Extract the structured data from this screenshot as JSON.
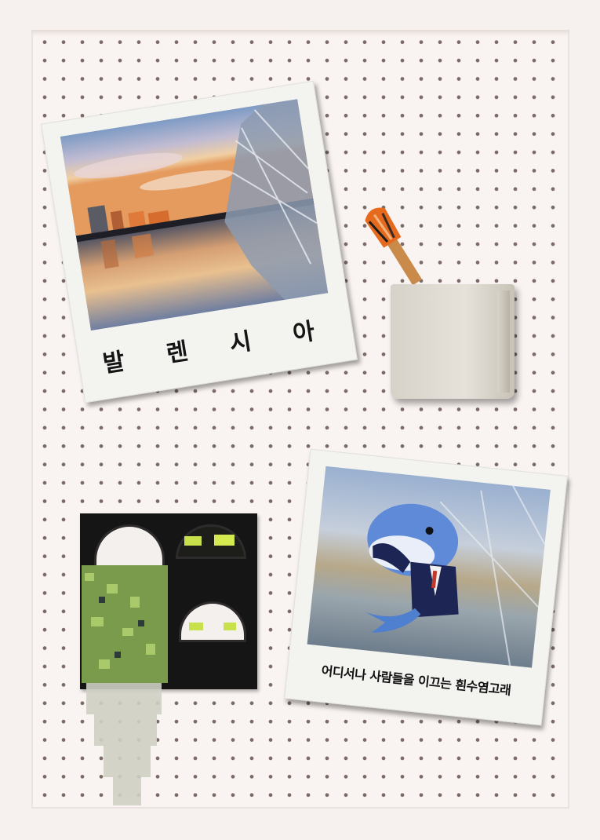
{
  "board": {
    "style": "pegboard",
    "dot_color": "#7a6a66",
    "background_color": "#f9f3f1"
  },
  "polaroid_left": {
    "caption": "발 렌 시 아",
    "photo_subject": "city-skyline-bridge-sunset"
  },
  "polaroid_right": {
    "caption": "어디서나 사람들을 이끄는 흰수염고래",
    "photo_subject": "whale-in-suit-bridge"
  },
  "decorations": {
    "cup_icon": "cup-icon",
    "brush_icon": "paintbrush-icon",
    "planter_icon": "planter-icon",
    "ivy_icon": "ivy-icon"
  }
}
